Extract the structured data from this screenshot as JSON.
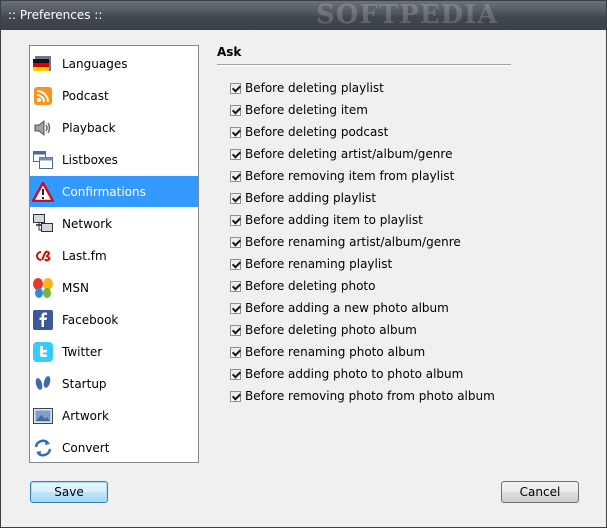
{
  "window": {
    "title": ":: Preferences ::",
    "watermark": "SOFTPEDIA"
  },
  "sidebar": {
    "items": [
      {
        "label": "Languages",
        "icon": "flag-germany-icon",
        "selected": false
      },
      {
        "label": "Podcast",
        "icon": "rss-icon",
        "selected": false
      },
      {
        "label": "Playback",
        "icon": "speaker-icon",
        "selected": false
      },
      {
        "label": "Listboxes",
        "icon": "listbox-windows-icon",
        "selected": false
      },
      {
        "label": "Confirmations",
        "icon": "warning-triangle-icon",
        "selected": true
      },
      {
        "label": "Network",
        "icon": "network-computers-icon",
        "selected": false
      },
      {
        "label": "Last.fm",
        "icon": "lastfm-icon",
        "selected": false
      },
      {
        "label": "MSN",
        "icon": "msn-butterfly-icon",
        "selected": false
      },
      {
        "label": "Facebook",
        "icon": "facebook-icon",
        "selected": false
      },
      {
        "label": "Twitter",
        "icon": "twitter-icon",
        "selected": false
      },
      {
        "label": "Startup",
        "icon": "footprints-icon",
        "selected": false
      },
      {
        "label": "Artwork",
        "icon": "artwork-picture-icon",
        "selected": false
      },
      {
        "label": "Convert",
        "icon": "convert-arrows-icon",
        "selected": false
      }
    ]
  },
  "main": {
    "section_title": "Ask",
    "options": [
      {
        "label": "Before deleting playlist",
        "checked": true
      },
      {
        "label": "Before deleting item",
        "checked": true
      },
      {
        "label": "Before deleting podcast",
        "checked": true
      },
      {
        "label": "Before deleting artist/album/genre",
        "checked": true
      },
      {
        "label": "Before removing item from playlist",
        "checked": true
      },
      {
        "label": "Before adding playlist",
        "checked": true
      },
      {
        "label": "Before adding item to playlist",
        "checked": true
      },
      {
        "label": "Before renaming artist/album/genre",
        "checked": true
      },
      {
        "label": "Before renaming playlist",
        "checked": true
      },
      {
        "label": "Before deleting photo",
        "checked": true
      },
      {
        "label": "Before adding a new photo album",
        "checked": true
      },
      {
        "label": "Before deleting photo album",
        "checked": true
      },
      {
        "label": "Before renaming photo album",
        "checked": true
      },
      {
        "label": "Before adding photo to photo album",
        "checked": true
      },
      {
        "label": "Before removing photo from photo album",
        "checked": true
      }
    ]
  },
  "buttons": {
    "save_label": "Save",
    "cancel_label": "Cancel"
  },
  "colors": {
    "selection": "#3399ff",
    "titlebar": "#4d535a"
  }
}
